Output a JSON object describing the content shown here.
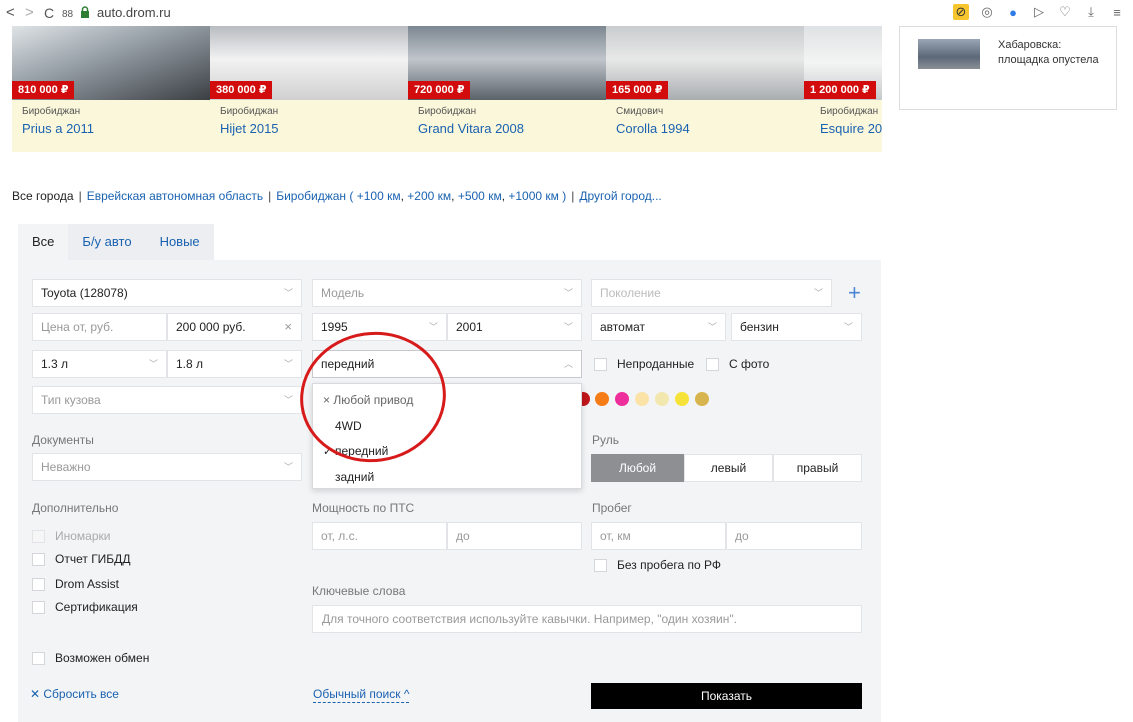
{
  "browser": {
    "back": "<",
    "forward": ">",
    "reload": "C",
    "grid": "88",
    "url": "auto.drom.ru"
  },
  "cars": [
    {
      "price": "810 000 ₽",
      "city": "Биробиджан",
      "name": "Prius a 2011"
    },
    {
      "price": "380 000 ₽",
      "city": "Биробиджан",
      "name": "Hijet 2015"
    },
    {
      "price": "720 000 ₽",
      "city": "Биробиджан",
      "name": "Grand Vitara 2008"
    },
    {
      "price": "165 000 ₽",
      "city": "Смидович",
      "name": "Corolla 1994"
    },
    {
      "price": "1 200 000 ₽",
      "city": "Биробиджан",
      "name": "Esquire 20"
    }
  ],
  "news": {
    "text": "Хабаровска: площадка опустела"
  },
  "cities": {
    "all": "Все города",
    "region": "Еврейская автономная область",
    "city": "Биробиджан",
    "open": "(",
    "r100": "+100 км",
    "r200": "+200 км",
    "r500": "+500 км",
    "r1000": "+1000 км",
    "close": ")",
    "other": "Другой город..."
  },
  "tabs": [
    {
      "label": "Все"
    },
    {
      "label": "Б/у авто"
    },
    {
      "label": "Новые"
    }
  ],
  "filters": {
    "brand": "Toyota (128078)",
    "model": "Модель",
    "generation": "Поколение",
    "price_from": "Цена от, руб.",
    "price_to": "200 000 руб.",
    "year_from": "1995",
    "year_to": "2001",
    "transmission": "автомат",
    "fuel": "бензин",
    "volume_from": "1.3 л",
    "volume_to": "1.8 л",
    "drive": "передний",
    "unsold": "Непроданные",
    "with_photo": "С фото",
    "body": "Тип кузова",
    "documents_label": "Документы",
    "documents": "Неважно",
    "steering_label": "Руль",
    "steering": [
      "Любой",
      "левый",
      "правый"
    ],
    "extra_label": "Дополнительно",
    "extras": [
      "Иномарки",
      "Отчет ГИБДД",
      "Drom Assist",
      "Сертификация"
    ],
    "power_label": "Мощность по ПТС",
    "power_from": "от, л.с.",
    "power_to": "до",
    "mileage_label": "Пробег",
    "mileage_from": "от, км",
    "mileage_to": "до",
    "no_mileage_rf": "Без пробега по РФ",
    "keywords_label": "Ключевые слова",
    "keywords_placeholder": "Для точного соответствия используйте кавычки. Например, \"один хозяин\".",
    "exchange": "Возможен обмен"
  },
  "drive_dropdown": {
    "any": "× Любой привод",
    "options": [
      "4WD",
      "передний",
      "задний"
    ],
    "selected_mark": "✓"
  },
  "colors": [
    "#c0161b",
    "#f57c16",
    "#ee2e9a",
    "#fbe3a8",
    "#f3e7b0",
    "#f6e33a",
    "#d8b44e"
  ],
  "bottom": {
    "reset": "✕ Сбросить все",
    "simple_search": "Обычный поиск ^",
    "show": "Показать"
  }
}
